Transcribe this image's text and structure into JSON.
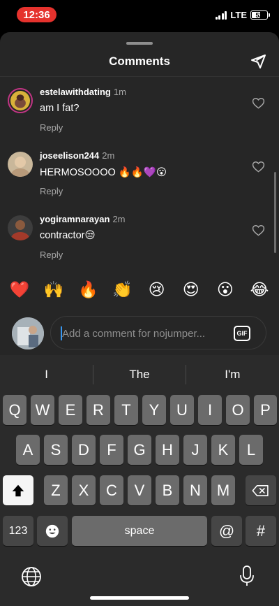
{
  "status_bar": {
    "time": "12:36",
    "network": "LTE",
    "battery": "52"
  },
  "sheet": {
    "title": "Comments"
  },
  "comments": [
    {
      "username": "estelawithdating",
      "time": "1m",
      "text": "am I fat?",
      "reply_label": "Reply"
    },
    {
      "username": "joseelison244",
      "time": "2m",
      "text": "HERMOSOOOO 🔥🔥💜😮",
      "reply_label": "Reply"
    },
    {
      "username": "yogiramnarayan",
      "time": "2m",
      "text": "contractor😒",
      "reply_label": "Reply"
    }
  ],
  "quick_reactions": [
    "❤️",
    "🙌",
    "🔥",
    "👏",
    "😢",
    "😍",
    "😮",
    "😂"
  ],
  "comment_input": {
    "placeholder": "Add a comment for nojumper...",
    "gif_label": "GIF"
  },
  "keyboard": {
    "suggestions": [
      "I",
      "The",
      "I'm"
    ],
    "row1": [
      "Q",
      "W",
      "E",
      "R",
      "T",
      "Y",
      "U",
      "I",
      "O",
      "P"
    ],
    "row2": [
      "A",
      "S",
      "D",
      "F",
      "G",
      "H",
      "J",
      "K",
      "L"
    ],
    "row3": [
      "Z",
      "X",
      "C",
      "V",
      "B",
      "N",
      "M"
    ],
    "numbers_label": "123",
    "space_label": "space",
    "at_label": "@",
    "hash_label": "#"
  },
  "colors": {
    "accent": "#3897f0",
    "time_pill": "#e5322d",
    "sheet_bg": "#262626",
    "keyboard_bg": "#2b2b2b"
  }
}
